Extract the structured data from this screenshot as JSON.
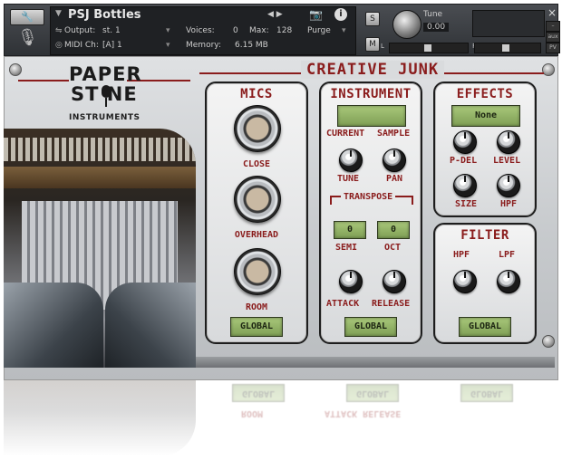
{
  "header": {
    "instrument_name": "PSJ Bottles",
    "output_label": "Output:",
    "output_value": "st. 1",
    "voices_label": "Voices:",
    "voices_value": "0",
    "max_label": "Max:",
    "max_value": "128",
    "purge_label": "Purge",
    "midi_label": "MIDI Ch:",
    "midi_value": "[A] 1",
    "memory_label": "Memory:",
    "memory_value": "6.15 MB",
    "solo_label": "S",
    "mute_label": "M",
    "tune_label": "Tune",
    "tune_value": "0.00",
    "pan_left": "L",
    "pan_right": "R",
    "aux_label": "aux",
    "pv_label": "PV",
    "close_label": "×"
  },
  "brand": {
    "logo_line1": "PAPER",
    "logo_line2": "ST  NE",
    "logo_line3": "INSTRUMENTS",
    "title": "CREATIVE JUNK"
  },
  "mics": {
    "title": "MICS",
    "knobs": [
      "CLOSE",
      "OVERHEAD",
      "ROOM"
    ],
    "global_label": "GLOBAL"
  },
  "instrument": {
    "title": "INSTRUMENT",
    "display_value": "",
    "current_label": "CURRENT",
    "sample_label": "SAMPLE",
    "tune_label": "TUNE",
    "pan_label": "PAN",
    "transpose_label": "TRANSPOSE",
    "semi_value": "0",
    "oct_value": "0",
    "semi_label": "SEMI",
    "oct_label": "OCT",
    "attack_label": "ATTACK",
    "release_label": "RELEASE",
    "global_label": "GLOBAL"
  },
  "effects": {
    "title": "EFFECTS",
    "display_value": "None",
    "pdel_label": "P-DEL",
    "level_label": "LEVEL",
    "size_label": "SIZE",
    "hpf_label": "HPF"
  },
  "filter": {
    "title": "FILTER",
    "hpf_label": "HPF",
    "lpf_label": "LPF",
    "global_label": "GLOBAL"
  },
  "reflection": {
    "row1": "ATTACK RELEASE",
    "row2": "ROOM",
    "global_label": "GLOBAL"
  },
  "colors": {
    "accent": "#8a1c1c",
    "lcd": "#95b565"
  }
}
